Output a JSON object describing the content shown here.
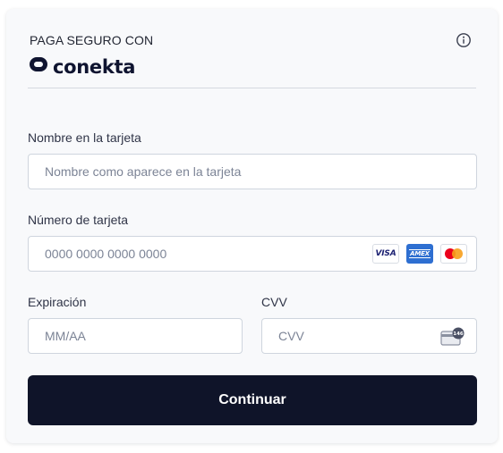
{
  "header": {
    "pay_secure_text": "PAGA SEGURO CON",
    "logo_text": "conekta",
    "info_icon": "info-icon"
  },
  "form": {
    "name": {
      "label": "Nombre en la tarjeta",
      "placeholder": "Nombre como aparece en la tarjeta",
      "value": ""
    },
    "card_number": {
      "label": "Número de tarjeta",
      "placeholder": "0000 0000 0000 0000",
      "value": "",
      "brands": [
        "VISA",
        "AMEX",
        "mastercard"
      ]
    },
    "expiration": {
      "label": "Expiración",
      "placeholder": "MM/AA",
      "value": ""
    },
    "cvv": {
      "label": "CVV",
      "placeholder": "CVV",
      "value": "",
      "card_icon_text": "146"
    }
  },
  "submit": {
    "label": "Continuar"
  },
  "colors": {
    "button_bg": "#0f1429",
    "brand_text": "#0f1430",
    "amex_blue": "#2e6fd1",
    "visa_blue": "#1a1f71",
    "mastercard_red": "#eb001b",
    "mastercard_orange": "#f79e1b"
  }
}
